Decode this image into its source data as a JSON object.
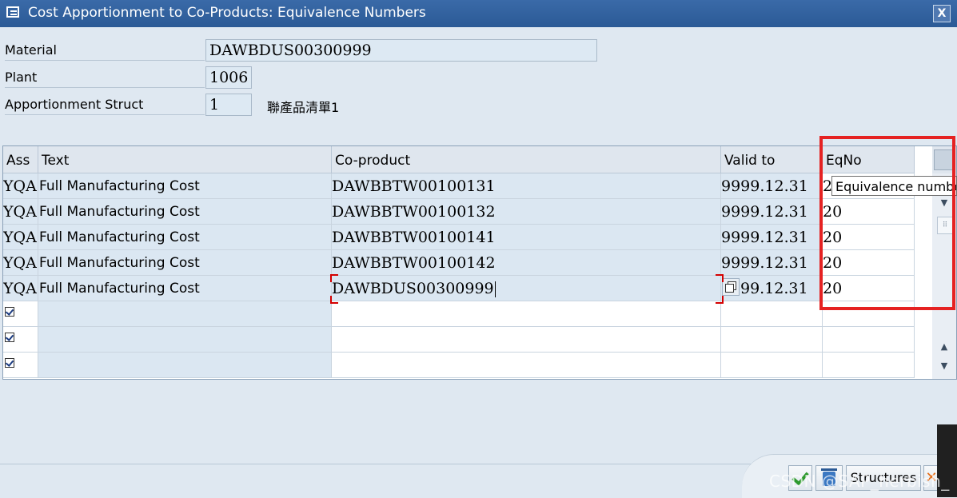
{
  "window": {
    "title": "Cost Apportionment to Co-Products: Equivalence Numbers",
    "close_label": "X"
  },
  "form": {
    "material_label": "Material",
    "material_value": "DAWBDUS00300999",
    "plant_label": "Plant",
    "plant_value": "1006",
    "struct_label": "Apportionment Struct",
    "struct_value": "1",
    "struct_desc": "聯產品清單1"
  },
  "table": {
    "columns": [
      "Ass",
      "Text",
      "Co-product",
      "Valid to",
      "EqNo"
    ],
    "rows": [
      {
        "ass": "YQA",
        "text": "Full Manufacturing Cost",
        "coproduct": "DAWBBTW00100131",
        "valid_to": "9999.12.31",
        "eqno": "2"
      },
      {
        "ass": "YQA",
        "text": "Full Manufacturing Cost",
        "coproduct": "DAWBBTW00100132",
        "valid_to": "9999.12.31",
        "eqno": "20"
      },
      {
        "ass": "YQA",
        "text": "Full Manufacturing Cost",
        "coproduct": "DAWBBTW00100141",
        "valid_to": "9999.12.31",
        "eqno": "20"
      },
      {
        "ass": "YQA",
        "text": "Full Manufacturing Cost",
        "coproduct": "DAWBBTW00100142",
        "valid_to": "9999.12.31",
        "eqno": "20"
      },
      {
        "ass": "YQA",
        "text": "Full Manufacturing Cost",
        "coproduct": "DAWBDUS00300999",
        "valid_to": "99.12.31",
        "eqno": "20"
      }
    ],
    "tooltip": "Equivalence number"
  },
  "footer": {
    "structures_label": "Structures",
    "watermark": "CSDN @SAP_herbish_"
  },
  "colors": {
    "titlebar": "#2b5a96",
    "highlight": "#e52222",
    "readonly_cell": "#dbe7f2"
  }
}
